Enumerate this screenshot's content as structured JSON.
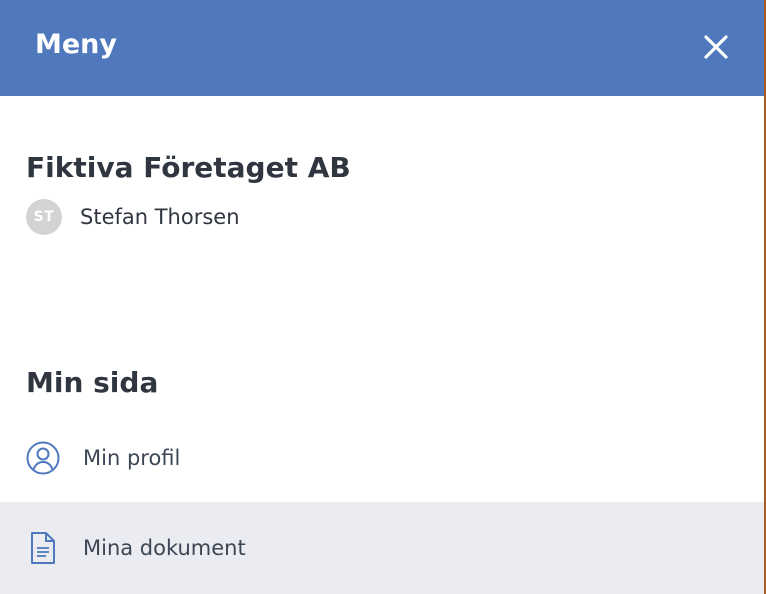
{
  "header": {
    "title": "Meny",
    "close_icon": "close-icon"
  },
  "account": {
    "company": "Fiktiva Företaget AB",
    "user_initials": "ST",
    "user_name": "Stefan Thorsen"
  },
  "section": {
    "title": "Min sida",
    "items": [
      {
        "label": "Min profil",
        "icon": "user-circle-icon",
        "highlighted": false
      },
      {
        "label": "Mina dokument",
        "icon": "document-icon",
        "highlighted": true
      }
    ]
  },
  "colors": {
    "header_bg": "#4f78bd",
    "highlight_bg": "#eaecf1",
    "icon_color": "#4f78bd",
    "text": "#2f3640"
  }
}
